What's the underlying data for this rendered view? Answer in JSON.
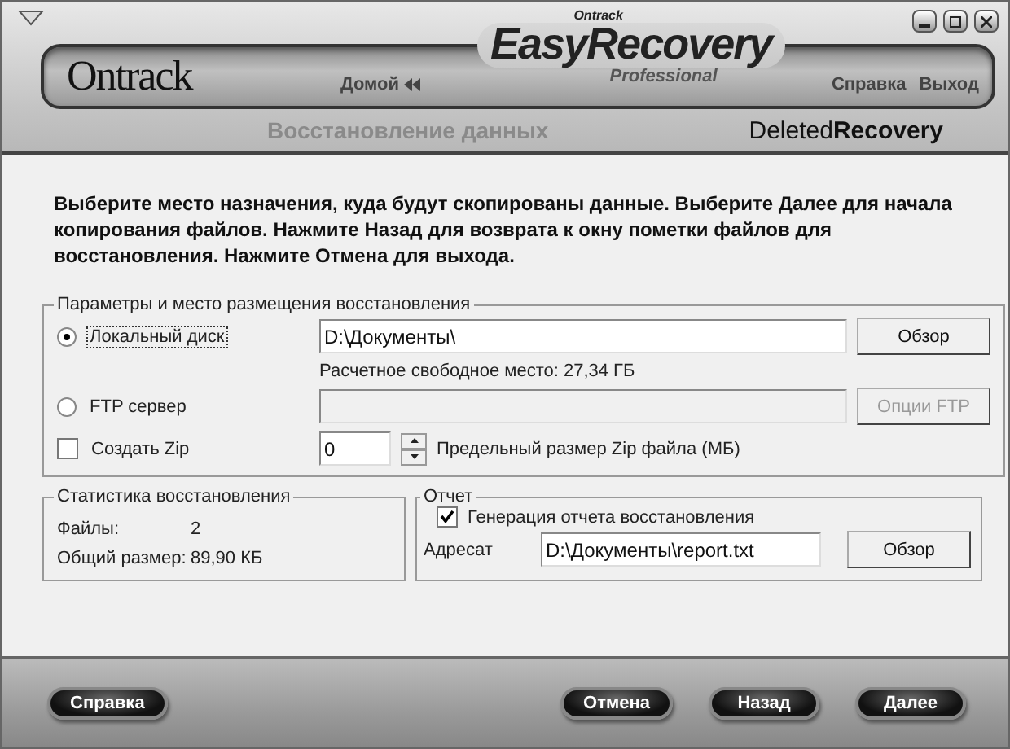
{
  "header": {
    "brand_small": "Ontrack",
    "product": "EasyRecovery",
    "edition": "Professional",
    "company": "Ontrack",
    "home_link": "Домой",
    "links": [
      "Справка",
      "Выход"
    ],
    "section_title": "Восстановление данных",
    "module": "Deleted**Recovery**"
  },
  "instructions": "Выберите место назначения, куда будут скопированы данные. Выберите Далее для начала копирования файлов. Нажмите Назад для возврата к окну пометки файлов для восстановления. Нажмите Отмена для выхода.",
  "destination": {
    "title": "Параметры и место размещения восстановления",
    "local": {
      "label": "Локальный диск",
      "selected": true,
      "value": "D:\\Документы\\",
      "button": "Обзор"
    },
    "free_space": "Расчетное свободное место: 27,34 ГБ",
    "ftp": {
      "label": "FTP сервер",
      "selected": false,
      "button": "Опции FTP",
      "disabled": true
    },
    "zip": {
      "label": "Создать Zip",
      "checked": false,
      "value": "0",
      "size_label": "Предельный размер Zip файла (МБ)"
    }
  },
  "statistics": {
    "title": "Статистика восстановления",
    "rows": [
      {
        "label": "Файлы:",
        "value": "2"
      },
      {
        "label": "Общий размер:",
        "value": "89,90 КБ"
      }
    ]
  },
  "report": {
    "title": "Отчет",
    "generate_label": "Генерация отчета восстановления",
    "generate_checked": true,
    "addressee_label": "Адресат",
    "addressee_value": "D:\\Документы\\report.txt",
    "button": "Обзор"
  },
  "footer": {
    "left_buttons": [
      "Справка"
    ],
    "right_buttons": [
      "Отмена",
      "Назад",
      "Далее"
    ]
  }
}
